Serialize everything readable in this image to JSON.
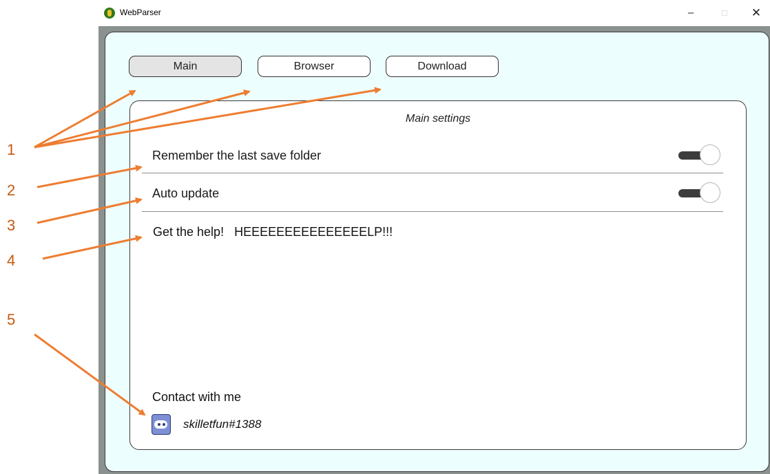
{
  "window": {
    "title": "WebParser",
    "minimize_glyph": "–",
    "maximize_glyph": "□",
    "close_glyph": "✕"
  },
  "tabs": [
    {
      "label": "Main",
      "active": true
    },
    {
      "label": "Browser",
      "active": false
    },
    {
      "label": "Download",
      "active": false
    }
  ],
  "main_settings": {
    "title": "Main settings",
    "settings": [
      {
        "label": "Remember the last save folder",
        "enabled": true
      },
      {
        "label": "Auto update",
        "enabled": true
      }
    ],
    "help_text": "Get the help!   HEEEEEEEEEEEEEEELP!!!",
    "contact_label": "Contact with me",
    "discord_handle": "skilletfun#1388"
  },
  "annotations": {
    "callouts": [
      "1",
      "2",
      "3",
      "4",
      "5"
    ],
    "color": "#ED7D31"
  },
  "colors": {
    "panel_bg": "#edfefe",
    "frame_bg": "#8a918f",
    "active_tab_bg": "#e4e4e4",
    "toggle_track": "#3c3c3c"
  }
}
